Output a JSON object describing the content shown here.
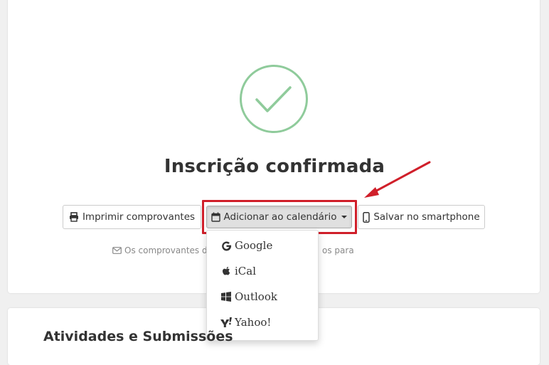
{
  "confirmation": {
    "title": "Inscrição confirmada"
  },
  "actions": {
    "print_label": "Imprimir comprovantes",
    "calendar_label": "Adicionar ao calendário",
    "phone_label": "Salvar no smartphone"
  },
  "note": {
    "start": "Os comprovantes d",
    "end": "os para"
  },
  "calendar_menu": {
    "items": [
      {
        "label": "Google",
        "icon": "google-icon"
      },
      {
        "label": "iCal",
        "icon": "apple-icon"
      },
      {
        "label": "Outlook",
        "icon": "windows-icon"
      },
      {
        "label": "Yahoo!",
        "icon": "yahoo-icon"
      }
    ]
  },
  "section": {
    "title": "Atividades e Submissões"
  },
  "colors": {
    "success_green": "#8fcb9b",
    "highlight_red": "#d01f2a"
  }
}
